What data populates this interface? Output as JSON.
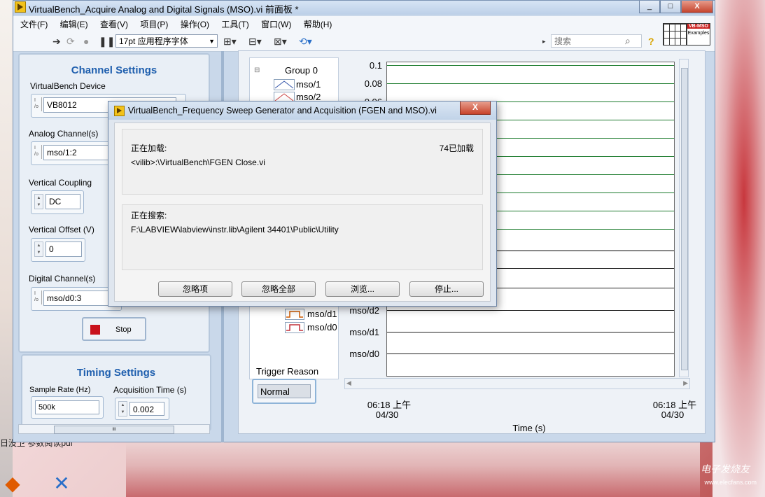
{
  "window": {
    "title": "VirtualBench_Acquire Analog and Digital Signals (MSO).vi 前面板 *",
    "controls": {
      "minimize": "_",
      "maximize": "□",
      "close": "X"
    }
  },
  "menubar": [
    "文件(F)",
    "编辑(E)",
    "查看(V)",
    "项目(P)",
    "操作(O)",
    "工具(T)",
    "窗口(W)",
    "帮助(H)"
  ],
  "toolbar": {
    "font": "17pt 应用程序字体",
    "search_placeholder": "搜索",
    "help": "?",
    "vi_icon_label": "VB-MSO",
    "vi_icon_sub": "Examples"
  },
  "channel_settings": {
    "title": "Channel Settings",
    "device_label": "VirtualBench Device",
    "device_value": "VB8012",
    "analog_label": "Analog Channel(s)",
    "analog_value": "mso/1:2",
    "coupling_label": "Vertical Coupling",
    "coupling_value": "DC",
    "offset_label": "Vertical Offset (V)",
    "offset_value": "0",
    "digital_label": "Digital Channel(s)",
    "digital_value": "mso/d0:3",
    "stop_label": "Stop"
  },
  "timing_settings": {
    "title": "Timing Settings",
    "rate_label": "Sample Rate (Hz)",
    "rate_value": "500k",
    "time_label": "Acquisition Time (s)",
    "time_value": "0.002"
  },
  "graph": {
    "legend_group": "Group 0",
    "legend_items": [
      "mso/1",
      "mso/2"
    ],
    "legend_digital": [
      "mso/d1",
      "mso/d0"
    ],
    "y_ticks": [
      "0.1",
      "0.08",
      "0.06"
    ],
    "digital_rows": [
      "mso/d2",
      "mso/d1",
      "mso/d0"
    ],
    "x_left_time": "06:18 上午",
    "x_left_date": "04/30",
    "x_right_time": "06:18 上午",
    "x_right_date": "04/30",
    "x_axis_label": "Time (s)",
    "trigger_label": "Trigger Reason",
    "trigger_value": "Normal"
  },
  "dialog": {
    "title": "VirtualBench_Frequency Sweep Generator and Acquisition (FGEN and MSO).vi",
    "close": "X",
    "loading_label": "正在加载:",
    "loaded_count": "74已加载",
    "loading_path": "<vilib>:\\VirtualBench\\FGEN Close.vi",
    "searching_label": "正在搜索:",
    "searching_path": "F:\\LABVIEW\\labview\\instr.lib\\Agilent 34401\\Public\\Utility",
    "buttons": [
      "忽略项",
      "忽略全部",
      "浏览...",
      "停止..."
    ]
  },
  "desktop": {
    "below_text": "日没卫    参数阅读pdf",
    "watermark": "电子发烧友",
    "watermark_url": "www.elecfans.com"
  }
}
